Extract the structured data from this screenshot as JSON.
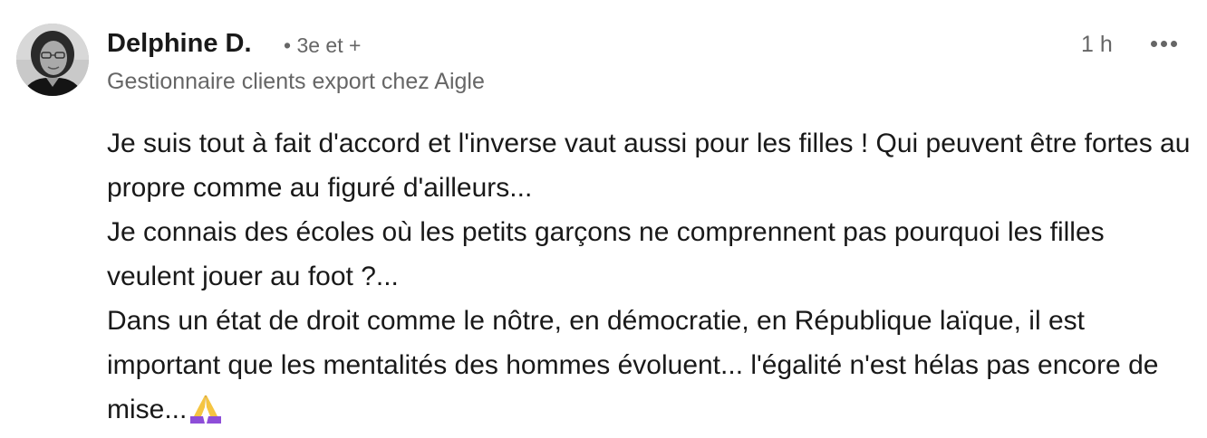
{
  "comment": {
    "author": {
      "name": "Delphine D.",
      "degree": "• 3e et +",
      "headline": "Gestionnaire clients export chez Aigle",
      "avatar_icon": "profile-photo"
    },
    "timestamp": "1 h",
    "more_icon": "ellipsis-icon",
    "body": {
      "paragraphs": [
        "Je suis tout à fait d'accord et l'inverse vaut aussi pour les filles ! Qui peuvent être fortes au propre comme au figuré d'ailleurs...",
        "Je connais des écoles où les petits garçons ne comprennent pas pourquoi les filles veulent jouer au foot ?...",
        "Dans un état de droit comme le nôtre, en démocratie, en République laïque, il est important que les mentalités des hommes évoluent... l'égalité n'est hélas pas encore de mise..."
      ],
      "trailing_emoji": "folded-hands-icon"
    }
  },
  "colors": {
    "primary_text": "#191919",
    "secondary_text": "#666666",
    "emoji_hands": "#f5c542",
    "emoji_sleeve": "#8e4ed8"
  }
}
